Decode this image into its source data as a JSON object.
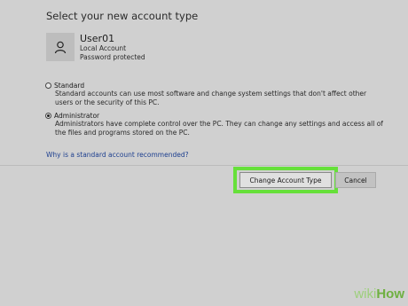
{
  "dialog": {
    "heading": "Select your new account type"
  },
  "user": {
    "avatar_icon": "person-icon",
    "name": "User01",
    "account_kind": "Local Account",
    "password_status": "Password protected"
  },
  "options": {
    "standard": {
      "label": "Standard",
      "description": "Standard accounts can use most software and change system settings that don't affect other users or the security of this PC.",
      "selected": false
    },
    "administrator": {
      "label": "Administrator",
      "description": "Administrators have complete control over the PC. They can change any settings and access all of the files and programs stored on the PC.",
      "selected": true
    }
  },
  "help_link": "Why is a standard account recommended?",
  "buttons": {
    "change_account_type": "Change Account Type",
    "cancel": "Cancel"
  },
  "watermark": {
    "wiki": "wiki",
    "how": "How"
  },
  "colors": {
    "background": "#d0d0d0",
    "highlight": "#66e03a",
    "link": "#1d3f8f"
  }
}
